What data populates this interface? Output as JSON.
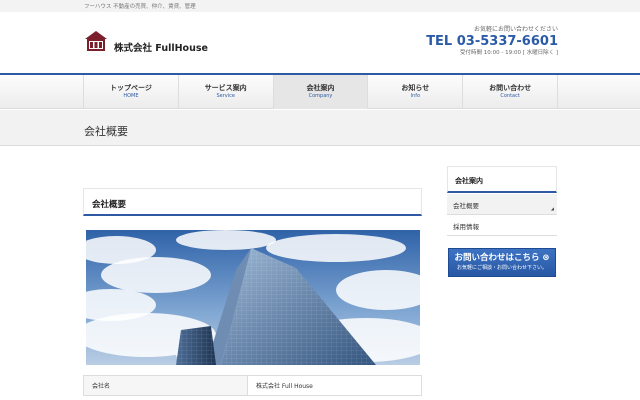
{
  "header": {
    "tagline": "フーハウス 不動産の売買、仲介、賃貸、管理",
    "company_name": "株式会社 FullHouse",
    "contact_note": "お気軽にお問い合わせください",
    "tel": "TEL 03-5337-6601",
    "hours": "受付時間 10:00 - 19:00 [ 水曜日除く ]"
  },
  "nav": [
    {
      "jp": "トップページ",
      "en": "HOME"
    },
    {
      "jp": "サービス案内",
      "en": "Service"
    },
    {
      "jp": "会社案内",
      "en": "Company"
    },
    {
      "jp": "お知らせ",
      "en": "Info"
    },
    {
      "jp": "お問い合わせ",
      "en": "Contact"
    }
  ],
  "page_title": "会社概要",
  "content": {
    "heading": "会社概要",
    "table": [
      {
        "label": "会社名",
        "value": "株式会社 Full House"
      }
    ]
  },
  "sidebar": {
    "heading": "会社案内",
    "items": [
      "会社概要",
      "採用情報"
    ],
    "cta_main": "お問い合わせはこちら",
    "cta_sub": "お気軽にご相談・お問い合わせ下さい。"
  },
  "colors": {
    "accent": "#2f5aa3",
    "tel": "#2a5aa8"
  }
}
